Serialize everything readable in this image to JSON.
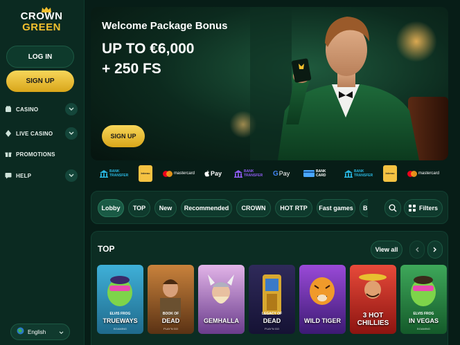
{
  "brand": {
    "line1": "CROWN",
    "line2": "GREEN"
  },
  "auth": {
    "login": "LOG IN",
    "signup": "SIGN UP"
  },
  "nav": [
    {
      "label": "CASINO",
      "icon": "casino-icon",
      "expandable": true
    },
    {
      "label": "LIVE CASINO",
      "icon": "live-casino-icon",
      "expandable": true
    },
    {
      "label": "PROMOTIONS",
      "icon": "gift-icon",
      "expandable": false
    },
    {
      "label": "HELP",
      "icon": "chat-icon",
      "expandable": true
    }
  ],
  "language": {
    "label": "English",
    "icon": "globe-icon"
  },
  "banner": {
    "title": "Welcome Package Bonus",
    "headline1": "UP TO €6,000",
    "headline2": "+ 250 FS",
    "cta": "SIGN UP"
  },
  "payments": [
    {
      "name": "BANK TRANSFER",
      "line1": "BANK",
      "line2": "TRANSFER",
      "color": "#29b6e0"
    },
    {
      "name": "Interac",
      "label": "Interac",
      "color": "#f5c242"
    },
    {
      "name": "mastercard",
      "label": "mastercard",
      "color": "#eb001b"
    },
    {
      "name": "Apple Pay",
      "label": "Pay",
      "color": "#ffffff"
    },
    {
      "name": "BANK TRANSFER",
      "line1": "BANK",
      "line2": "TRANSFER",
      "color": "#8e5cf0"
    },
    {
      "name": "Google Pay",
      "label": "Pay",
      "color": "#ffffff"
    },
    {
      "name": "BANK CARD",
      "line1": "BANK",
      "line2": "CARD",
      "color": "#4aa8ff"
    },
    {
      "name": "BANK TRANSFER",
      "line1": "BANK",
      "line2": "TRANSFER",
      "color": "#29b6e0"
    },
    {
      "name": "Interac",
      "label": "Interac",
      "color": "#f5c242"
    },
    {
      "name": "mastercard",
      "label": "mastercard",
      "color": "#eb001b"
    }
  ],
  "filters": {
    "chips": [
      "Lobby",
      "TOP",
      "New",
      "Recommended",
      "CROWN",
      "HOT RTP",
      "Fast games",
      "B"
    ],
    "active": "Lobby",
    "filters_label": "Filters"
  },
  "top_section": {
    "title": "TOP",
    "view_all": "View all",
    "games": [
      {
        "pre": "ELVIS FROG",
        "name": "TRUEWAYS",
        "sub": "BGAMING",
        "bg1": "#3fb0d8",
        "bg2": "#1f6a8c"
      },
      {
        "pre": "BOOK OF",
        "name": "DEAD",
        "sub": "PLAY'N GO",
        "bg1": "#c9823c",
        "bg2": "#5a3214"
      },
      {
        "pre": "",
        "name": "GEMHALLA",
        "sub": "",
        "bg1": "#e2b4e8",
        "bg2": "#6a3c8c"
      },
      {
        "pre": "LEGACY OF",
        "name": "DEAD",
        "sub": "PLAY'N GO",
        "bg1": "#2f2a5a",
        "bg2": "#151234"
      },
      {
        "pre": "",
        "name": "WILD TIGER",
        "sub": "",
        "bg1": "#9a4ad8",
        "bg2": "#3c1a74"
      },
      {
        "pre": "",
        "name": "3 HOT CHILLIES",
        "sub": "",
        "bg1": "#e84a3a",
        "bg2": "#8c1410"
      },
      {
        "pre": "ELVIS FROG",
        "name": "IN VEGAS",
        "sub": "BGAMING",
        "bg1": "#3ea85a",
        "bg2": "#145a2a"
      }
    ]
  },
  "colors": {
    "accent_gold": "#f4c02e",
    "bg": "#071d17",
    "panel": "#0c2d23"
  }
}
